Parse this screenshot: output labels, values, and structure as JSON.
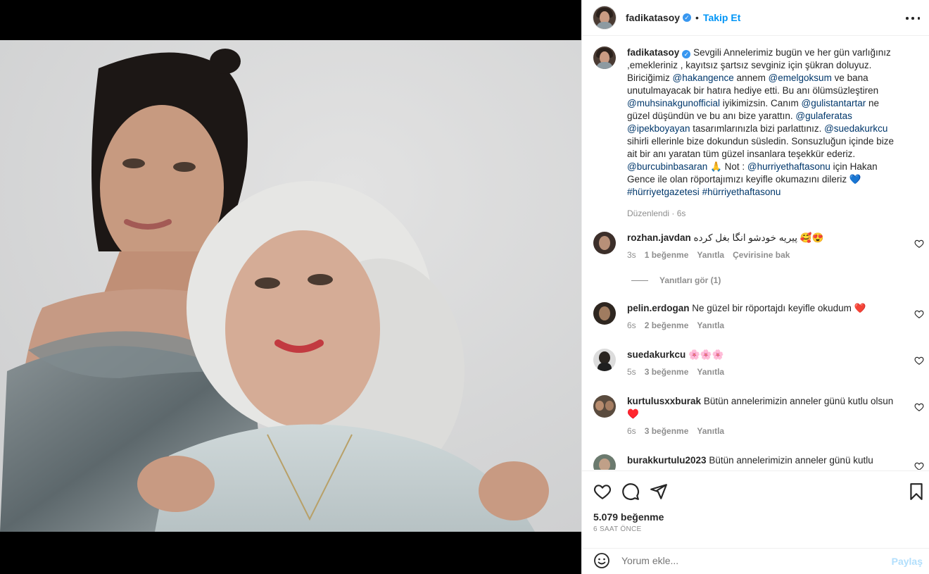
{
  "header": {
    "username": "fadikatasoy",
    "separator": "•",
    "follow_label": "Takip Et"
  },
  "caption": {
    "username": "fadikatasoy",
    "segments": [
      {
        "t": "Sevgili Annelerimiz bugün ve her gün varlığınız ,emekleriniz , kayıtsız şartsız sevginiz için şükran doluyuz. Biriciğimiz ",
        "m": false
      },
      {
        "t": "@hakangence",
        "m": true
      },
      {
        "t": " annem ",
        "m": false
      },
      {
        "t": "@emelgoksum",
        "m": true
      },
      {
        "t": " ve bana unutulmayacak bir hatıra hediye etti. Bu anı ölümsüzleştiren ",
        "m": false
      },
      {
        "t": "@muhsinakgunofficial",
        "m": true
      },
      {
        "t": " iyikimizsin. Canım ",
        "m": false
      },
      {
        "t": "@gulistantartar",
        "m": true
      },
      {
        "t": " ne güzel düşündün ve bu anı bize yarattın. ",
        "m": false
      },
      {
        "t": "@gulaferatas",
        "m": true
      },
      {
        "t": " ",
        "m": false
      },
      {
        "t": "@ipekboyayan",
        "m": true
      },
      {
        "t": " tasarımlarınızla bizi parlattınız. ",
        "m": false
      },
      {
        "t": "@suedakurkcu",
        "m": true
      },
      {
        "t": " sihirli ellerinle bize dokundun süsledin. Sonsuzluğun içinde bize ait bir anı yaratan tüm güzel insanlara teşekkür ederiz. ",
        "m": false
      },
      {
        "t": "@burcubinbasaran",
        "m": true
      },
      {
        "t": " 🙏 Not : ",
        "m": false
      },
      {
        "t": "@hurriyethaftasonu",
        "m": true
      },
      {
        "t": " için Hakan Gence ile olan röportajımızı keyifle okumazını dileriz 💙 ",
        "m": false
      },
      {
        "t": "#hürriyetgazetesi",
        "m": true
      },
      {
        "t": " ",
        "m": false
      },
      {
        "t": "#hürriyethaftasonu",
        "m": true
      }
    ],
    "edited": "Düzenlendi",
    "dot": "·",
    "age": "6s"
  },
  "comments": [
    {
      "user": "rozhan.javdan",
      "text": "پیریه خودشو انگا بغل کرده 🥰😍",
      "age": "3s",
      "likes": "1 beğenme",
      "reply": "Yanıtla",
      "translate": "Çevirisine bak"
    },
    {
      "user": "pelin.erdogan",
      "text": "Ne güzel bir röportajdı keyifle okudum ❤️",
      "age": "6s",
      "likes": "2 beğenme",
      "reply": "Yanıtla"
    },
    {
      "user": "suedakurkcu",
      "text": "🌸🌸🌸",
      "age": "5s",
      "likes": "3 beğenme",
      "reply": "Yanıtla"
    },
    {
      "user": "kurtulusxxburak",
      "text": "Bütün annelerimizin anneler günü kutlu olsun ♥️",
      "age": "6s",
      "likes": "3 beğenme",
      "reply": "Yanıtla"
    },
    {
      "user": "burakkurtulu2023",
      "text": "Bütün annelerimizin anneler günü kutlu"
    }
  ],
  "view_replies": "Yanıtları gör (1)",
  "footer": {
    "likes": "5.079 beğenme",
    "time": "6 SAAT ÖNCE",
    "comment_placeholder": "Yorum ekle...",
    "share_label": "Paylaş"
  },
  "colors": {
    "link": "#00376b",
    "follow": "#0095f6",
    "muted": "#8e8e8e",
    "like_red": "#ed4956"
  }
}
